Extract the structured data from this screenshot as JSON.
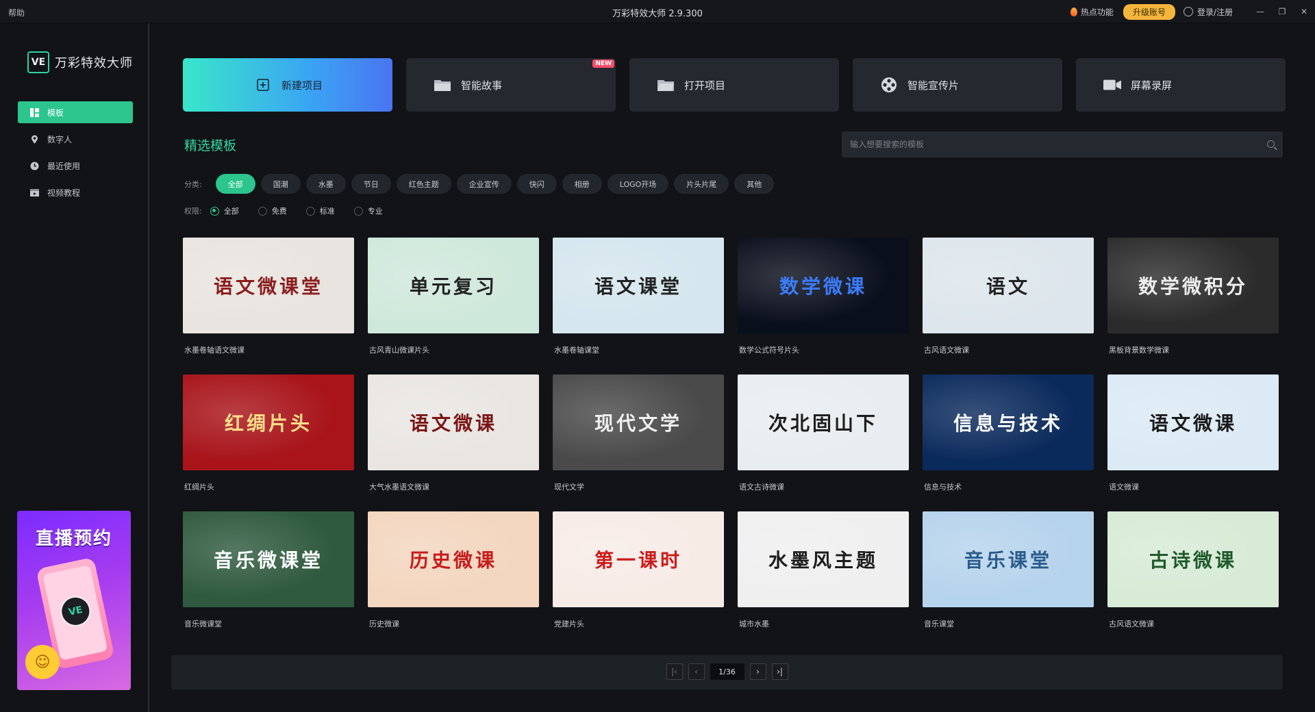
{
  "titlebar": {
    "help": "帮助",
    "title": "万彩特效大师 2.9.300",
    "hot": "热点功能",
    "upgrade": "升级账号",
    "login": "登录/注册"
  },
  "sidebar": {
    "logo_badge": "VE",
    "logo_text": "万彩特效大师",
    "items": [
      {
        "label": "模板",
        "icon": "template-icon",
        "active": true
      },
      {
        "label": "数字人",
        "icon": "digital-human-icon",
        "active": false
      },
      {
        "label": "最近使用",
        "icon": "clock-icon",
        "active": false
      },
      {
        "label": "视频教程",
        "icon": "video-tutorial-icon",
        "active": false
      }
    ],
    "promo": {
      "title": "直播预约",
      "badge": "VE"
    }
  },
  "actions": [
    {
      "label": "新建项目",
      "icon": "plus-square-icon",
      "primary": true
    },
    {
      "label": "智能故事",
      "icon": "folder-icon",
      "badge": "NEW"
    },
    {
      "label": "打开项目",
      "icon": "folder-open-icon"
    },
    {
      "label": "智能宣传片",
      "icon": "film-reel-icon"
    },
    {
      "label": "屏幕录屏",
      "icon": "camera-icon"
    }
  ],
  "section": {
    "title": "精选模板"
  },
  "search": {
    "placeholder": "输入想要搜索的模板"
  },
  "filters": {
    "label": "分类:",
    "chips": [
      "全部",
      "国潮",
      "水墨",
      "节日",
      "红色主题",
      "企业宣传",
      "快闪",
      "相册",
      "LOGO开场",
      "片头片尾",
      "其他"
    ],
    "active": "全部"
  },
  "permissions": {
    "label": "权限:",
    "options": [
      "全部",
      "免费",
      "标准",
      "专业"
    ],
    "selected": "全部"
  },
  "templates": [
    {
      "title": "语文微课堂",
      "label": "水墨卷轴语文微课",
      "bg": "#e8e4df",
      "fg": "#8b1d1d"
    },
    {
      "title": "单元复习",
      "label": "古风青山微课片头",
      "bg": "#cfe8dc",
      "fg": "#222"
    },
    {
      "title": "语文课堂",
      "label": "水墨卷轴课堂",
      "bg": "#d5e6ee",
      "fg": "#222"
    },
    {
      "title": "数学微课",
      "label": "数学公式符号片头",
      "bg": "#0a0f1c",
      "fg": "#3a7dff"
    },
    {
      "title": "语文",
      "label": "古风语文微课",
      "bg": "#dde6ec",
      "fg": "#222"
    },
    {
      "title": "数学微积分",
      "label": "黑板背景数学微课",
      "bg": "#2b2b2b",
      "fg": "#eee"
    },
    {
      "title": "红绸片头",
      "label": "红绸片头",
      "bg": "#a8141a",
      "fg": "#ffe08a"
    },
    {
      "title": "语文微课",
      "label": "大气水墨语文微课",
      "bg": "#e9e6e2",
      "fg": "#7a1515"
    },
    {
      "title": "现代文学",
      "label": "现代文学",
      "bg": "#4a4a4a",
      "fg": "#f0f0f0"
    },
    {
      "title": "次北固山下",
      "label": "语文古诗微课",
      "bg": "#e9edf0",
      "fg": "#1d1d1d"
    },
    {
      "title": "信息与技术",
      "label": "信息与技术",
      "bg": "#0b2a5c",
      "fg": "#ffffff"
    },
    {
      "title": "语文微课",
      "label": "语文微课",
      "bg": "#dbeaf5",
      "fg": "#1a1a1a"
    },
    {
      "title": "音乐微课堂",
      "label": "音乐微课堂",
      "bg": "#2f5a3f",
      "fg": "#ffffff"
    },
    {
      "title": "历史微课",
      "label": "历史微课",
      "bg": "#f3d6bf",
      "fg": "#c61c1c"
    },
    {
      "title": "第一课时",
      "label": "党建片头",
      "bg": "#f7ebe6",
      "fg": "#cc1a1a"
    },
    {
      "title": "水墨风主题",
      "label": "城市水墨",
      "bg": "#efeff0",
      "fg": "#1c1c1c"
    },
    {
      "title": "音乐课堂",
      "label": "音乐课堂",
      "bg": "#b6d3ec",
      "fg": "#2a5c8c"
    },
    {
      "title": "古诗微课",
      "label": "古风语文微课",
      "bg": "#d7ebd6",
      "fg": "#1e5a2a"
    }
  ],
  "pagination": {
    "first": "⏮",
    "prev": "‹",
    "page": "1/36",
    "next": "›",
    "last": "⏭"
  }
}
